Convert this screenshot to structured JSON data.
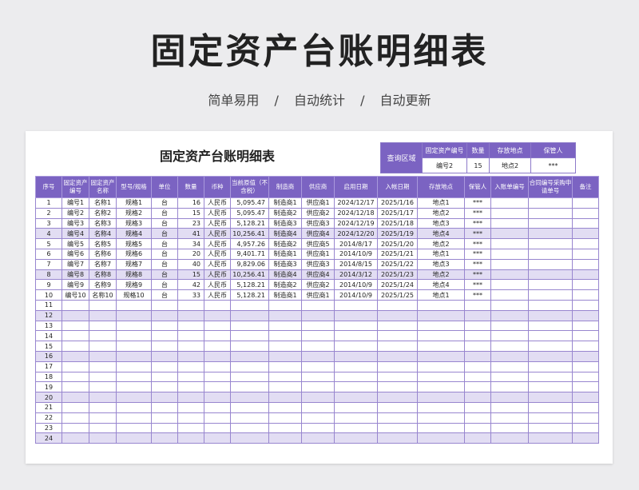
{
  "page": {
    "title": "固定资产台账明细表",
    "subtitle": "简单易用  /  自动统计  /  自动更新"
  },
  "sheet": {
    "title": "固定资产台账明细表",
    "query": {
      "label": "查询区域",
      "headers": [
        "固定资产编号",
        "数量",
        "存放地点",
        "保管人"
      ],
      "values": [
        "编号2",
        "15",
        "地点2",
        "***"
      ]
    },
    "columns": [
      "序号",
      "固定资产编号",
      "固定资产名称",
      "型号/规格",
      "单位",
      "数量",
      "币种",
      "当前原值（不含税）",
      "制造商",
      "供应商",
      "启用日期",
      "入帐日期",
      "存放地点",
      "保管人",
      "入账单编号",
      "合同编号采购申请单号",
      "备注"
    ],
    "rows": [
      [
        "1",
        "编号1",
        "名称1",
        "规格1",
        "台",
        "16",
        "人民币",
        "5,095.47",
        "制造商1",
        "供应商1",
        "2024/12/17",
        "2025/1/16",
        "地点1",
        "***",
        "",
        "",
        ""
      ],
      [
        "2",
        "编号2",
        "名称2",
        "规格2",
        "台",
        "15",
        "人民币",
        "5,095.47",
        "制造商2",
        "供应商2",
        "2024/12/18",
        "2025/1/17",
        "地点2",
        "***",
        "",
        "",
        ""
      ],
      [
        "3",
        "编号3",
        "名称3",
        "规格3",
        "台",
        "23",
        "人民币",
        "5,128.21",
        "制造商3",
        "供应商3",
        "2024/12/19",
        "2025/1/18",
        "地点3",
        "***",
        "",
        "",
        ""
      ],
      [
        "4",
        "编号4",
        "名称4",
        "规格4",
        "台",
        "41",
        "人民币",
        "10,256.41",
        "制造商4",
        "供应商4",
        "2024/12/20",
        "2025/1/19",
        "地点4",
        "***",
        "",
        "",
        ""
      ],
      [
        "5",
        "编号5",
        "名称5",
        "规格5",
        "台",
        "34",
        "人民币",
        "4,957.26",
        "制造商2",
        "供应商5",
        "2014/8/17",
        "2025/1/20",
        "地点2",
        "***",
        "",
        "",
        ""
      ],
      [
        "6",
        "编号6",
        "名称6",
        "规格6",
        "台",
        "20",
        "人民币",
        "9,401.71",
        "制造商1",
        "供应商1",
        "2014/10/9",
        "2025/1/21",
        "地点1",
        "***",
        "",
        "",
        ""
      ],
      [
        "7",
        "编号7",
        "名称7",
        "规格7",
        "台",
        "40",
        "人民币",
        "9,829.06",
        "制造商3",
        "供应商3",
        "2014/8/15",
        "2025/1/22",
        "地点3",
        "***",
        "",
        "",
        ""
      ],
      [
        "8",
        "编号8",
        "名称8",
        "规格8",
        "台",
        "15",
        "人民币",
        "10,256.41",
        "制造商4",
        "供应商4",
        "2014/3/12",
        "2025/1/23",
        "地点2",
        "***",
        "",
        "",
        ""
      ],
      [
        "9",
        "编号9",
        "名称9",
        "规格9",
        "台",
        "42",
        "人民币",
        "5,128.21",
        "制造商2",
        "供应商2",
        "2014/10/9",
        "2025/1/24",
        "地点4",
        "***",
        "",
        "",
        ""
      ],
      [
        "10",
        "编号10",
        "名称10",
        "规格10",
        "台",
        "33",
        "人民币",
        "5,128.21",
        "制造商1",
        "供应商1",
        "2014/10/9",
        "2025/1/25",
        "地点1",
        "***",
        "",
        "",
        ""
      ],
      [
        "11",
        "",
        "",
        "",
        "",
        "",
        "",
        "",
        "",
        "",
        "",
        "",
        "",
        "",
        "",
        "",
        ""
      ],
      [
        "12",
        "",
        "",
        "",
        "",
        "",
        "",
        "",
        "",
        "",
        "",
        "",
        "",
        "",
        "",
        "",
        ""
      ],
      [
        "13",
        "",
        "",
        "",
        "",
        "",
        "",
        "",
        "",
        "",
        "",
        "",
        "",
        "",
        "",
        "",
        ""
      ],
      [
        "14",
        "",
        "",
        "",
        "",
        "",
        "",
        "",
        "",
        "",
        "",
        "",
        "",
        "",
        "",
        "",
        ""
      ],
      [
        "15",
        "",
        "",
        "",
        "",
        "",
        "",
        "",
        "",
        "",
        "",
        "",
        "",
        "",
        "",
        "",
        ""
      ],
      [
        "16",
        "",
        "",
        "",
        "",
        "",
        "",
        "",
        "",
        "",
        "",
        "",
        "",
        "",
        "",
        "",
        ""
      ],
      [
        "17",
        "",
        "",
        "",
        "",
        "",
        "",
        "",
        "",
        "",
        "",
        "",
        "",
        "",
        "",
        "",
        ""
      ],
      [
        "18",
        "",
        "",
        "",
        "",
        "",
        "",
        "",
        "",
        "",
        "",
        "",
        "",
        "",
        "",
        "",
        ""
      ],
      [
        "19",
        "",
        "",
        "",
        "",
        "",
        "",
        "",
        "",
        "",
        "",
        "",
        "",
        "",
        "",
        "",
        ""
      ],
      [
        "20",
        "",
        "",
        "",
        "",
        "",
        "",
        "",
        "",
        "",
        "",
        "",
        "",
        "",
        "",
        "",
        ""
      ],
      [
        "21",
        "",
        "",
        "",
        "",
        "",
        "",
        "",
        "",
        "",
        "",
        "",
        "",
        "",
        "",
        "",
        ""
      ],
      [
        "22",
        "",
        "",
        "",
        "",
        "",
        "",
        "",
        "",
        "",
        "",
        "",
        "",
        "",
        "",
        "",
        ""
      ],
      [
        "23",
        "",
        "",
        "",
        "",
        "",
        "",
        "",
        "",
        "",
        "",
        "",
        "",
        "",
        "",
        "",
        ""
      ],
      [
        "24",
        "",
        "",
        "",
        "",
        "",
        "",
        "",
        "",
        "",
        "",
        "",
        "",
        "",
        "",
        "",
        ""
      ]
    ]
  }
}
